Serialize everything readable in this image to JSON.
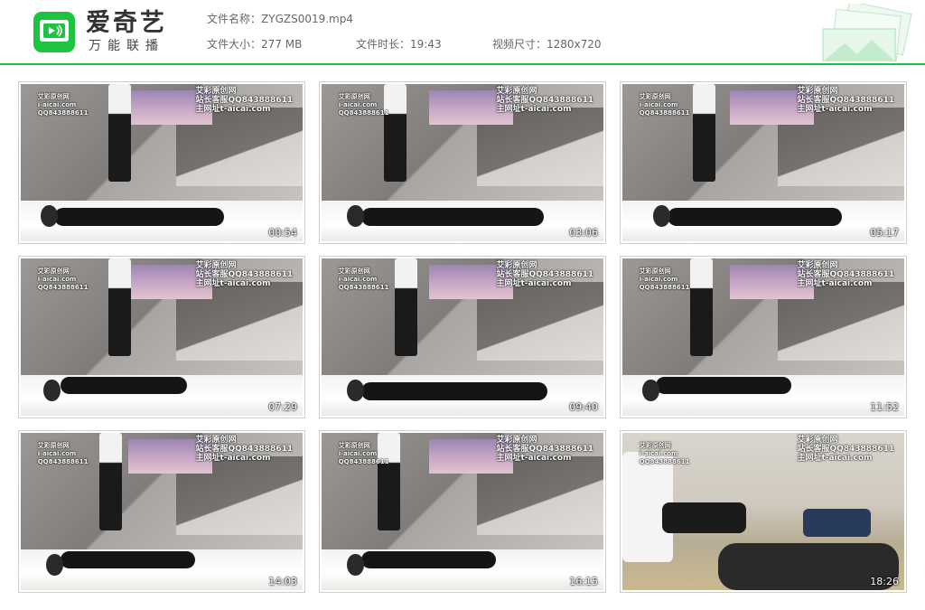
{
  "brand": {
    "name": "爱奇艺",
    "subtitle": "万能联播",
    "accent": "#1ec43f",
    "icon": "iqiyi-tv-icon"
  },
  "file_info": {
    "name_label": "文件名称：",
    "name_value": "ZYGZS0019.mp4",
    "size_label": "文件大小：",
    "size_value": "277 MB",
    "duration_label": "文件时长：",
    "duration_value": "19:43",
    "resolution_label": "视频尺寸：",
    "resolution_value": "1280x720"
  },
  "watermark": {
    "left_line1": "艾彩原创网",
    "left_line2": "i-aicai.com",
    "left_line3": "QQ843888611",
    "right_line1": "艾彩原创网",
    "right_line2": "站长客服QQ843888611",
    "right_line3": "主网址t-aicai.com"
  },
  "thumbnails": [
    {
      "timestamp": "00:54"
    },
    {
      "timestamp": "03:06"
    },
    {
      "timestamp": "05:17"
    },
    {
      "timestamp": "07:29"
    },
    {
      "timestamp": "09:40"
    },
    {
      "timestamp": "11:52"
    },
    {
      "timestamp": "14:03"
    },
    {
      "timestamp": "16:15"
    },
    {
      "timestamp": "18:26"
    }
  ]
}
